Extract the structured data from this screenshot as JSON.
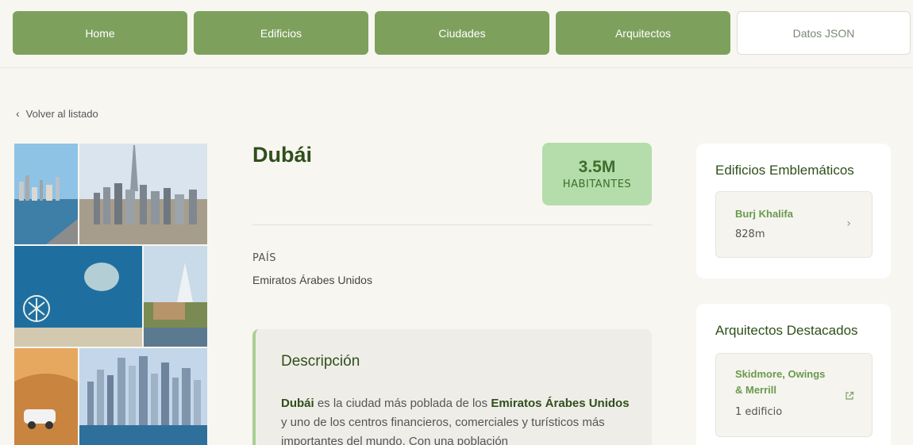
{
  "nav": {
    "items": [
      {
        "label": "Home"
      },
      {
        "label": "Edificios"
      },
      {
        "label": "Ciudades"
      },
      {
        "label": "Arquitectos"
      },
      {
        "label": "Datos JSON"
      }
    ]
  },
  "back": {
    "label": "Volver al listado",
    "icon": "chevron-left-icon"
  },
  "city": {
    "name": "Dubái",
    "population_value": "3.5M",
    "population_label": "HABITANTES",
    "country_label": "PAÍS",
    "country_value": "Emiratos Árabes Unidos"
  },
  "description": {
    "title": "Descripción",
    "bold_1": "Dubái",
    "text_1": " es la ciudad más poblada de los ",
    "bold_2": "Emiratos Árabes Unidos",
    "text_2": " y uno de los centros financieros, comerciales y turísticos más importantes del mundo. Con una población"
  },
  "buildings": {
    "title": "Edificios Emblemáticos",
    "items": [
      {
        "name": "Burj Khalifa",
        "height": "828m",
        "icon": "chevron-right-icon"
      }
    ]
  },
  "architects": {
    "title": "Arquitectos Destacados",
    "items": [
      {
        "name": "Skidmore, Owings & Merrill",
        "count": "1 edificio",
        "icon": "external-link-icon"
      }
    ]
  },
  "colors": {
    "primary_green": "#7da15d",
    "dark_green": "#2f4f1c",
    "badge_green": "#b5dcab",
    "background": "#f8f6f1"
  }
}
